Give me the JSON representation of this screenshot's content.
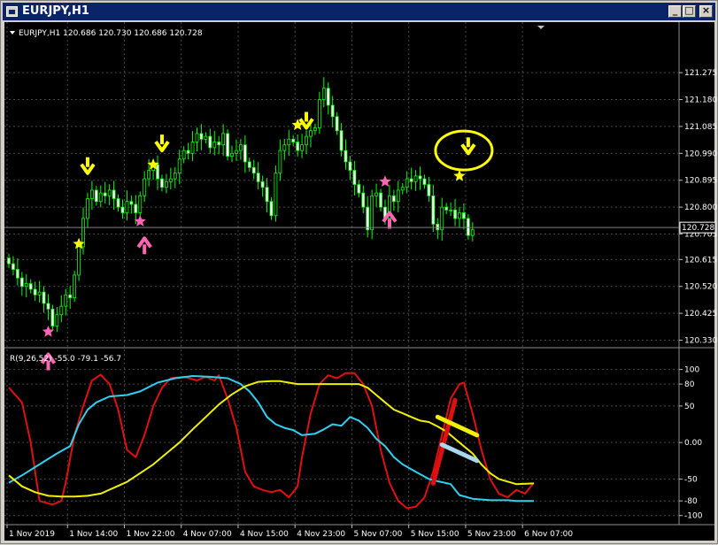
{
  "window": {
    "title": "EURJPY,H1",
    "buttons": {
      "minimize": "_",
      "maximize": "□",
      "close": "×"
    }
  },
  "colors": {
    "background": "#000000",
    "grid": "#4a4a4a",
    "candle": "#00ff00",
    "signal_down": "#ffff00",
    "signal_up": "#ff66b2",
    "osc_red": "#e01010",
    "osc_cyan": "#30d0f0",
    "osc_yellow": "#f0f000",
    "axis_text": "#ffffff"
  },
  "icons": {
    "close_arrow": "triangle-down-icon",
    "menu_arrow": "triangle-down-icon",
    "buy_arrow": "arrow-up-icon",
    "sell_arrow": "arrow-down-icon",
    "marker": "star-icon"
  },
  "chart_data": [
    {
      "type": "candlestick",
      "header": "EURJPY,H1  120.686 120.730 120.686 120.728",
      "y_ticks": [
        "121.275",
        "121.180",
        "121.085",
        "120.990",
        "120.895",
        "120.800",
        "120.705",
        "120.615",
        "120.520",
        "120.425",
        "120.330"
      ],
      "y_tick_values": [
        121.275,
        121.18,
        121.085,
        120.99,
        120.895,
        120.8,
        120.705,
        120.615,
        120.52,
        120.425,
        120.33
      ],
      "current_price": "120.728",
      "ylim": [
        120.316,
        121.366
      ],
      "close_values": [
        120.6,
        120.58,
        120.55,
        120.52,
        120.53,
        120.51,
        120.49,
        120.5,
        120.46,
        120.44,
        120.38,
        120.42,
        120.45,
        120.49,
        120.48,
        120.56,
        120.66,
        120.76,
        120.83,
        120.86,
        120.82,
        120.85,
        120.84,
        120.86,
        120.83,
        120.8,
        120.78,
        120.82,
        120.81,
        120.78,
        120.84,
        120.9,
        120.93,
        120.95,
        120.9,
        120.87,
        120.89,
        120.9,
        120.92,
        120.97,
        121.0,
        120.99,
        121.03,
        121.06,
        121.04,
        121.05,
        121.01,
        121.03,
        121.02,
        121.06,
        120.98,
        120.99,
        121.0,
        121.02,
        120.96,
        120.94,
        120.92,
        120.89,
        120.87,
        120.82,
        120.77,
        120.92,
        121.0,
        121.02,
        121.04,
        121.03,
        121.0,
        121.02,
        121.05,
        121.07,
        121.08,
        121.18,
        121.22,
        121.16,
        121.12,
        121.07,
        121.0,
        120.96,
        120.93,
        120.88,
        120.85,
        120.8,
        120.72,
        120.84,
        120.85,
        120.8,
        120.76,
        120.84,
        120.82,
        120.86,
        120.87,
        120.9,
        120.89,
        120.91,
        120.9,
        120.88,
        120.84,
        120.74,
        120.72,
        120.8,
        120.79,
        120.79,
        120.76,
        120.78,
        120.76,
        120.7,
        120.72
      ],
      "signals": [
        {
          "type": "sell",
          "bar": 18,
          "price": 120.92
        },
        {
          "type": "star_up",
          "bar": 16,
          "price": 120.67
        },
        {
          "type": "star_down",
          "bar": 9,
          "price": 120.36
        },
        {
          "type": "buy",
          "bar": 9,
          "price": 120.28
        },
        {
          "type": "sell",
          "bar": 35,
          "price": 121.0
        },
        {
          "type": "star_up",
          "bar": 33,
          "price": 120.95
        },
        {
          "type": "star_down",
          "bar": 30,
          "price": 120.75
        },
        {
          "type": "buy",
          "bar": 31,
          "price": 120.69
        },
        {
          "type": "sell",
          "bar": 68,
          "price": 121.08
        },
        {
          "type": "star_up",
          "bar": 66,
          "price": 121.09
        },
        {
          "type": "star_down",
          "bar": 86,
          "price": 120.89
        },
        {
          "type": "buy",
          "bar": 87,
          "price": 120.78
        },
        {
          "type": "sell",
          "bar": 105,
          "price": 120.99
        },
        {
          "type": "star_up",
          "bar": 103,
          "price": 120.91
        }
      ],
      "annotations": [
        {
          "shape": "ellipse",
          "bar": 104,
          "price": 121.0
        }
      ]
    },
    {
      "type": "line",
      "header": "R(9,26,52) -55.0 -79.1 -56.7",
      "y_ticks": [
        "100",
        "80",
        "50",
        "0.00",
        "-50",
        "-80",
        "-100"
      ],
      "y_tick_values": [
        100,
        80,
        50,
        0,
        -50,
        -80,
        -100
      ],
      "ylim": [
        -104,
        108
      ],
      "x_ticks": [
        "1 Nov 2019",
        "1 Nov 14:00",
        "1 Nov 22:00",
        "4 Nov 07:00",
        "4 Nov 15:00",
        "4 Nov 23:00",
        "5 Nov 07:00",
        "5 Nov 15:00",
        "5 Nov 23:00",
        "6 Nov 07:00"
      ],
      "x_tick_bars": [
        0,
        13,
        26,
        39,
        52,
        65,
        78,
        91,
        104,
        117
      ],
      "series": [
        {
          "color": "#e01010",
          "points": [
            [
              0,
              75
            ],
            [
              3,
              55
            ],
            [
              5,
              0
            ],
            [
              7,
              -80
            ],
            [
              10,
              -85
            ],
            [
              12,
              -80
            ],
            [
              13,
              -55
            ],
            [
              15,
              10
            ],
            [
              17,
              50
            ],
            [
              19,
              85
            ],
            [
              21,
              93
            ],
            [
              23,
              80
            ],
            [
              25,
              45
            ],
            [
              27,
              -10
            ],
            [
              29,
              -20
            ],
            [
              31,
              10
            ],
            [
              33,
              50
            ],
            [
              35,
              75
            ],
            [
              37,
              88
            ],
            [
              40,
              90
            ],
            [
              43,
              85
            ],
            [
              45,
              90
            ],
            [
              47,
              85
            ],
            [
              48,
              92
            ],
            [
              50,
              60
            ],
            [
              52,
              20
            ],
            [
              54,
              -40
            ],
            [
              56,
              -60
            ],
            [
              58,
              -65
            ],
            [
              60,
              -68
            ],
            [
              62,
              -65
            ],
            [
              64,
              -75
            ],
            [
              66,
              -60
            ],
            [
              67,
              -20
            ],
            [
              69,
              40
            ],
            [
              71,
              80
            ],
            [
              73,
              92
            ],
            [
              75,
              88
            ],
            [
              77,
              95
            ],
            [
              79,
              95
            ],
            [
              81,
              80
            ],
            [
              83,
              50
            ],
            [
              85,
              -10
            ],
            [
              87,
              -55
            ],
            [
              89,
              -80
            ],
            [
              91,
              -90
            ],
            [
              93,
              -88
            ],
            [
              95,
              -75
            ],
            [
              97,
              -40
            ],
            [
              99,
              10
            ],
            [
              101,
              60
            ],
            [
              103,
              80
            ],
            [
              104,
              82
            ],
            [
              106,
              40
            ],
            [
              108,
              -10
            ],
            [
              110,
              -50
            ],
            [
              112,
              -70
            ],
            [
              114,
              -75
            ],
            [
              116,
              -65
            ],
            [
              118,
              -70
            ],
            [
              120,
              -55
            ]
          ]
        },
        {
          "color": "#30d0f0",
          "points": [
            [
              0,
              -55
            ],
            [
              3,
              -45
            ],
            [
              7,
              -30
            ],
            [
              11,
              -15
            ],
            [
              14,
              -5
            ],
            [
              16,
              25
            ],
            [
              18,
              45
            ],
            [
              20,
              55
            ],
            [
              23,
              63
            ],
            [
              27,
              65
            ],
            [
              30,
              70
            ],
            [
              34,
              82
            ],
            [
              38,
              88
            ],
            [
              42,
              91
            ],
            [
              46,
              90
            ],
            [
              50,
              88
            ],
            [
              53,
              80
            ],
            [
              55,
              70
            ],
            [
              57,
              55
            ],
            [
              59,
              35
            ],
            [
              61,
              25
            ],
            [
              63,
              20
            ],
            [
              65,
              17
            ],
            [
              67,
              10
            ],
            [
              70,
              12
            ],
            [
              72,
              18
            ],
            [
              74,
              25
            ],
            [
              76,
              23
            ],
            [
              78,
              35
            ],
            [
              80,
              30
            ],
            [
              82,
              20
            ],
            [
              84,
              5
            ],
            [
              86,
              -5
            ],
            [
              88,
              -20
            ],
            [
              90,
              -30
            ],
            [
              93,
              -40
            ],
            [
              96,
              -50
            ],
            [
              98,
              -53
            ],
            [
              101,
              -57
            ],
            [
              103,
              -72
            ],
            [
              106,
              -77
            ],
            [
              110,
              -79
            ],
            [
              114,
              -79
            ],
            [
              116,
              -80
            ],
            [
              120,
              -80
            ]
          ]
        },
        {
          "color": "#f0f000",
          "points": [
            [
              0,
              -45
            ],
            [
              3,
              -60
            ],
            [
              6,
              -68
            ],
            [
              9,
              -73
            ],
            [
              12,
              -74
            ],
            [
              15,
              -74
            ],
            [
              18,
              -73
            ],
            [
              21,
              -70
            ],
            [
              24,
              -62
            ],
            [
              27,
              -54
            ],
            [
              30,
              -42
            ],
            [
              33,
              -30
            ],
            [
              36,
              -15
            ],
            [
              39,
              0
            ],
            [
              42,
              18
            ],
            [
              45,
              35
            ],
            [
              48,
              52
            ],
            [
              51,
              66
            ],
            [
              54,
              77
            ],
            [
              57,
              83
            ],
            [
              60,
              84
            ],
            [
              62,
              84
            ],
            [
              64,
              82
            ],
            [
              66,
              80
            ],
            [
              70,
              80
            ],
            [
              74,
              80
            ],
            [
              78,
              80
            ],
            [
              80,
              80
            ],
            [
              82,
              75
            ],
            [
              84,
              65
            ],
            [
              86,
              55
            ],
            [
              88,
              45
            ],
            [
              90,
              40
            ],
            [
              92,
              35
            ],
            [
              94,
              30
            ],
            [
              96,
              28
            ],
            [
              98,
              22
            ],
            [
              100,
              15
            ],
            [
              102,
              5
            ],
            [
              104,
              -5
            ],
            [
              106,
              -15
            ],
            [
              108,
              -30
            ],
            [
              110,
              -42
            ],
            [
              112,
              -50
            ],
            [
              116,
              -57
            ],
            [
              120,
              -56
            ]
          ]
        }
      ],
      "annotations": [
        {
          "shape": "line",
          "color": "#e01010",
          "from": [
            97,
            -56
          ],
          "to": [
            102,
            58
          ]
        },
        {
          "shape": "line",
          "color": "#f0f000",
          "from": [
            98,
            35
          ],
          "to": [
            107,
            10
          ]
        },
        {
          "shape": "line",
          "color": "#a8d8ee",
          "from": [
            99,
            -3
          ],
          "to": [
            107,
            -25
          ]
        }
      ]
    }
  ]
}
